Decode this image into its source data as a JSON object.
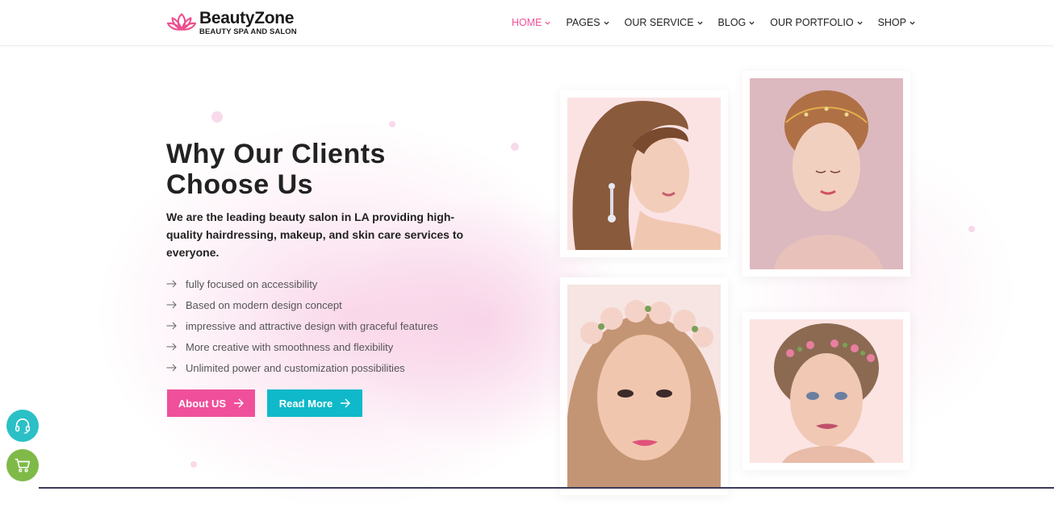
{
  "brand": {
    "name": "BeautyZone",
    "tagline": "BEAUTY SPA AND SALON",
    "logo_icon": "lotus-icon",
    "accent": "#f0509b"
  },
  "nav": {
    "items": [
      {
        "label": "HOME",
        "active": true
      },
      {
        "label": "PAGES"
      },
      {
        "label": "OUR SERVICE"
      },
      {
        "label": "BLOG"
      },
      {
        "label": "OUR PORTFOLIO"
      },
      {
        "label": "SHOP"
      }
    ],
    "chevron_icon": "chevron-down-icon"
  },
  "hero": {
    "heading": "Why Our Clients Choose Us",
    "lead": "We are the leading beauty salon in LA providing high-quality hairdressing, makeup, and skin care services to everyone.",
    "features": [
      "fully focused on accessibility",
      "Based on modern design concept",
      "impressive and attractive design with graceful features",
      "More creative with smoothness and flexibility",
      "Unlimited power and customization possibilities"
    ],
    "feature_icon": "arrow-right-icon",
    "buttons": {
      "about": {
        "label": "About US",
        "color": "#f0509b"
      },
      "read_more": {
        "label": "Read More",
        "color": "#0fb9c9"
      }
    }
  },
  "gallery": {
    "images": [
      {
        "name": "photo-woman-earrings"
      },
      {
        "name": "photo-woman-hair-vine"
      },
      {
        "name": "photo-woman-flower-crown"
      },
      {
        "name": "photo-woman-braided-crown"
      }
    ]
  },
  "widgets": {
    "support_icon": "headset-icon",
    "cart_icon": "cart-icon",
    "support_color": "#2bc0c6",
    "cart_color": "#7fba48"
  }
}
